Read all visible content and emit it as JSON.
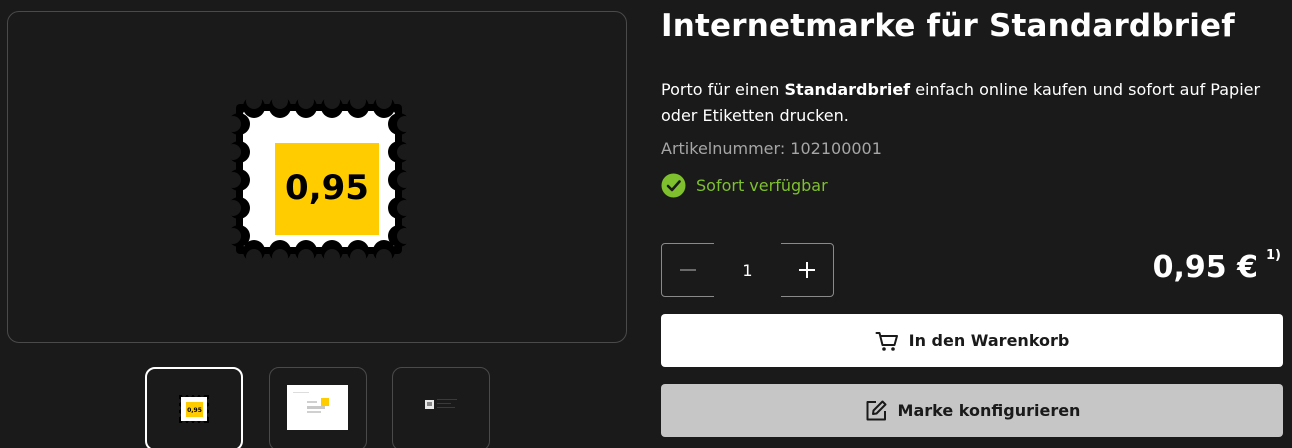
{
  "product": {
    "title": "Internetmarke für Standardbrief",
    "description_before": "Porto für einen ",
    "description_bold": "Standardbrief",
    "description_after": " einfach online kaufen und sofort auf Papier oder Etiketten drucken.",
    "article_number": "Artikelnummer: 102100001",
    "availability": "Sofort verfügbar",
    "stamp_value": "0,95"
  },
  "gallery": {
    "thumbnails": [
      {
        "icon": "stamp-thumbnail",
        "active": true
      },
      {
        "icon": "envelope-thumbnail",
        "active": false
      },
      {
        "icon": "document-thumbnail",
        "active": false
      }
    ]
  },
  "purchase": {
    "quantity": "1",
    "price": "0,95 €",
    "price_footnote": "1)",
    "add_to_cart_label": "In den Warenkorb",
    "configure_label": "Marke konfigurieren"
  },
  "colors": {
    "background": "#1a1a1a",
    "stamp_yellow": "#ffcc00",
    "available_green": "#7ec02e",
    "primary_button": "#ffffff",
    "secondary_button": "#c6c6c6"
  },
  "icons": {
    "minus": "minus-icon",
    "plus": "plus-icon",
    "cart": "cart-icon",
    "edit": "edit-icon",
    "availability": "check-circle-icon"
  }
}
